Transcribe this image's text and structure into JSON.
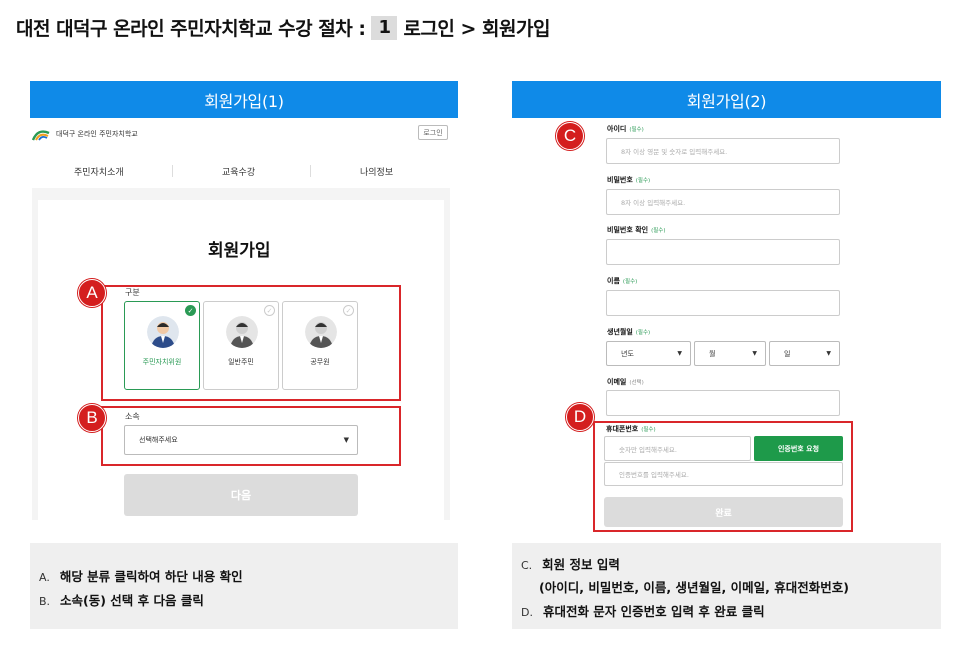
{
  "page": {
    "title_prefix": "대전 대덕구 온라인 주민자치학교 수강 절차 :",
    "step_number": "1",
    "title_suffix": "로그인 > 회원가입"
  },
  "left": {
    "banner": "회원가입(1)",
    "site_name": "대덕구 온라인 주민자치학교",
    "login_button": "로그인",
    "nav": [
      "주민자치소개",
      "교육수강",
      "나의정보"
    ],
    "heading": "회원가입",
    "category_label": "구분",
    "categories": [
      "주민자치위원",
      "일반주민",
      "공무원"
    ],
    "affiliation_label": "소속",
    "affiliation_value": "선택해주세요",
    "next_button": "다음",
    "badge_a": "A",
    "badge_b": "B"
  },
  "right": {
    "banner": "회원가입(2)",
    "badge_c": "C",
    "badge_d": "D",
    "required_tag": "(필수)",
    "optional_tag": "(선택)",
    "id_label": "아이디",
    "id_placeholder": "8자 이상 영문 및 숫자로 입력해주세요.",
    "pw_label": "비밀번호",
    "pw_placeholder": "8자 이상 입력해주세요.",
    "pw_confirm_label": "비밀번호 확인",
    "name_label": "이름",
    "birth_label": "생년월일",
    "birth_year": "년도",
    "birth_month": "월",
    "birth_day": "일",
    "email_label": "이메일",
    "phone_label": "휴대폰번호",
    "phone_placeholder": "숫자만 입력해주세요.",
    "verify_button": "인증번호 요청",
    "code_placeholder": "인증번호를 입력해주세요.",
    "complete_button": "완료"
  },
  "notes_left": {
    "a_marker": "A.",
    "a_text": "해당 분류 클릭하여 하단 내용 확인",
    "b_marker": "B.",
    "b_text": "소속(동) 선택 후 다음 클릭"
  },
  "notes_right": {
    "c_marker": "C.",
    "c_text": "회원 정보 입력",
    "c_detail": "(아이디, 비밀번호, 이름, 생년월일, 이메일, 휴대전화번호)",
    "d_marker": "D.",
    "d_text": "휴대전화 문자 인증번호 입력 후 완료 클릭"
  },
  "colors": {
    "banner": "#0f8ae8",
    "badge_red": "#d41e1e",
    "highlight_red": "#d9262a",
    "brand_green": "#2a9a55",
    "verify_green": "#1e9a4a"
  }
}
